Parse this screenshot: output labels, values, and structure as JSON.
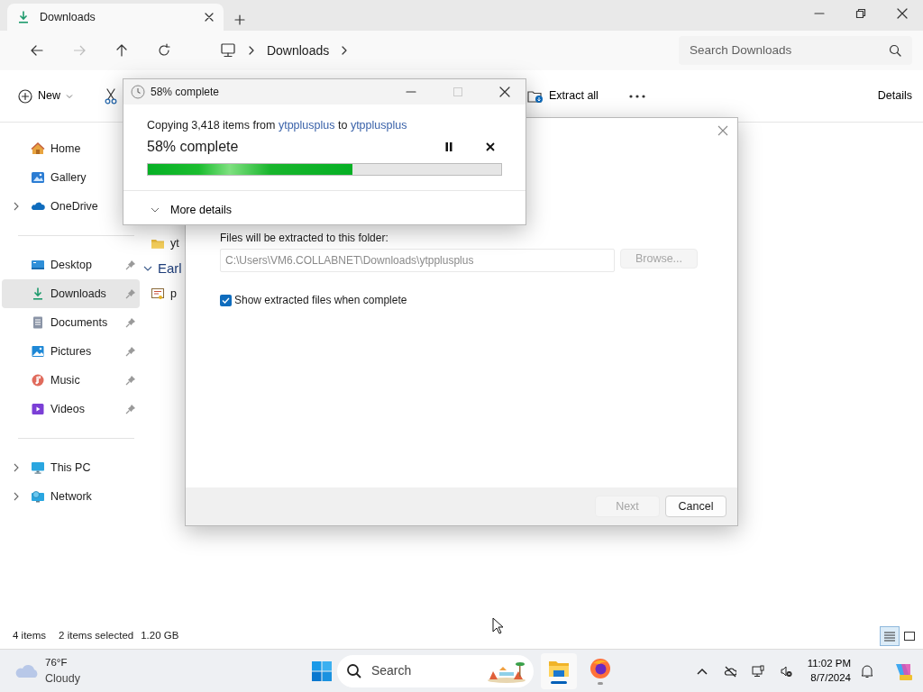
{
  "explorer": {
    "tab": {
      "title": "Downloads"
    },
    "breadcrumb": [
      "Downloads"
    ],
    "search": {
      "placeholder": "Search Downloads"
    },
    "commands": [
      {
        "kind": "new",
        "label": "New"
      },
      {
        "kind": "cut"
      },
      {
        "kind": "extract",
        "label": "Extract all"
      },
      {
        "kind": "more"
      }
    ],
    "details_label": "Details",
    "sidebar": [
      {
        "items": [
          {
            "kind": "home",
            "label": "Home",
            "expander": false,
            "pinned": false,
            "selected": false
          },
          {
            "kind": "gallery",
            "label": "Gallery",
            "expander": false,
            "pinned": false,
            "selected": false
          },
          {
            "kind": "onedrive",
            "label": "OneDrive",
            "expander": true,
            "pinned": false,
            "selected": false
          }
        ]
      },
      {
        "items": [
          {
            "kind": "desktop",
            "label": "Desktop",
            "expander": false,
            "pinned": true,
            "selected": false
          },
          {
            "kind": "downloads",
            "label": "Downloads",
            "expander": false,
            "pinned": true,
            "selected": true
          },
          {
            "kind": "documents",
            "label": "Documents",
            "expander": false,
            "pinned": true,
            "selected": false
          },
          {
            "kind": "pictures",
            "label": "Pictures",
            "expander": false,
            "pinned": true,
            "selected": false
          },
          {
            "kind": "music",
            "label": "Music",
            "expander": false,
            "pinned": true,
            "selected": false
          },
          {
            "kind": "videos",
            "label": "Videos",
            "expander": false,
            "pinned": true,
            "selected": false
          }
        ]
      },
      {
        "items": [
          {
            "kind": "pc",
            "label": "This PC",
            "expander": true,
            "pinned": false,
            "selected": false
          },
          {
            "kind": "network",
            "label": "Network",
            "expander": true,
            "pinned": false,
            "selected": false
          }
        ]
      }
    ],
    "content": [
      {
        "kind": "folder",
        "label": "yt"
      },
      {
        "kind": "group",
        "label": "Earl",
        "expanded": true
      },
      {
        "kind": "file",
        "label": "p"
      }
    ],
    "status_bar": {
      "item_count": "4 items",
      "selection": "2 items selected",
      "size": "1.20 GB"
    },
    "view_modes": [
      {
        "kind": "details",
        "selected": true
      },
      {
        "kind": "tiles",
        "selected": false
      }
    ]
  },
  "extract_dialog": {
    "folder_label": "Files will be extracted to this folder:",
    "path": "C:\\Users\\VM6.COLLABNET\\Downloads\\ytpplusplus",
    "browse": {
      "label": "Browse...",
      "disabled": true
    },
    "show_files": {
      "label": "Show extracted files when complete",
      "checked": true
    },
    "buttons": [
      {
        "label": "Next",
        "disabled": true
      },
      {
        "label": "Cancel",
        "disabled": false
      }
    ]
  },
  "progress_dialog": {
    "title": "58% complete",
    "message": [
      {
        "text": "Copying 3,418 items from",
        "link": false
      },
      {
        "text": "ytpplusplus",
        "link": true
      },
      {
        "text": "to",
        "link": false
      },
      {
        "text": "ytpplusplus",
        "link": true
      }
    ],
    "status": "58% complete",
    "level": 0.58,
    "more_details": "More details"
  },
  "taskbar": {
    "weather": {
      "temperature": "76°F",
      "condition": "Cloudy"
    },
    "search_placeholder": "Search",
    "apps": [
      {
        "kind": "explorer",
        "active": true
      },
      {
        "kind": "firefox",
        "active": false
      }
    ],
    "time": "11:02 PM",
    "date": "8/7/2024"
  }
}
